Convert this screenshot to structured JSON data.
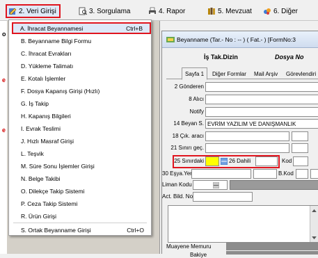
{
  "menubar": {
    "items": [
      {
        "label": "2. Veri Girişi",
        "icon": "data-entry-icon"
      },
      {
        "label": "3. Sorgulama",
        "icon": "query-icon"
      },
      {
        "label": "4. Rapor",
        "icon": "report-icon"
      },
      {
        "label": "5. Mevzuat",
        "icon": "legislation-icon"
      },
      {
        "label": "6. Diğer",
        "icon": "other-icon"
      }
    ]
  },
  "left_strip": {
    "letters": [
      "o",
      "e",
      "e"
    ]
  },
  "dropdown": {
    "items": [
      {
        "label": "A. İhracat Beyannamesi",
        "shortcut": "Ctrl+B"
      },
      {
        "label": "B. Beyanname Bilgi Formu",
        "shortcut": ""
      },
      {
        "label": "C. İhracat Evrakları",
        "shortcut": ""
      },
      {
        "label": "D. Yükleme Talimatı",
        "shortcut": ""
      },
      {
        "label": "E. Kotalı İşlemler",
        "shortcut": ""
      },
      {
        "label": "F. Dosya Kapanış Girişi (Hızlı)",
        "shortcut": ""
      },
      {
        "label": "G. İş Takip",
        "shortcut": ""
      },
      {
        "label": "H. Kapanış Bilgileri",
        "shortcut": ""
      },
      {
        "label": "I. Evrak Teslimi",
        "shortcut": ""
      },
      {
        "label": "J. Hızlı Masraf Girişi",
        "shortcut": ""
      },
      {
        "label": "L. Teşvik",
        "shortcut": ""
      },
      {
        "label": "M. Süre Sonu İşlemler Girişi",
        "shortcut": ""
      },
      {
        "label": "N. Belge Takibi",
        "shortcut": ""
      },
      {
        "label": "O. Dilekçe Takip Sistemi",
        "shortcut": ""
      },
      {
        "label": "P. Ceza Takip Sistemi",
        "shortcut": ""
      },
      {
        "label": "R. Ürün Girişi",
        "shortcut": ""
      },
      {
        "label": "S. Ortak Beyanname Girişi",
        "shortcut": "Ctrl+O"
      }
    ]
  },
  "form": {
    "title": "Beyanname (Tar.- No : -- ) ( Fat.- ) [FormNo:3",
    "header_left": "İş Tak.Dizin",
    "header_right": "Dosya No",
    "tabs": [
      "Sayfa 1",
      "Diğer Formlar",
      "Mail Arşiv",
      "Görevlendiri"
    ],
    "fields": {
      "gonderen": "2 Gönderen",
      "alici": "8 Alıcı",
      "notify": "Notify",
      "beyan_label": "14 Beyan S.",
      "beyan_value": "EVRİM YAZILIM VE DANIŞMANLIK",
      "cik_arac": "18 Çık. aracı",
      "sinir_gec": "21 Sınırı geç.",
      "sinirdaki": "25 Sınırdaki",
      "dahili": "26 Dahili",
      "kod": "Kod",
      "esya_yeri": "30 Eşya.Yeri",
      "bkod": "B.Kod",
      "liman_kodu": "Liman Kodu",
      "act_bild": "Act. Bild. No",
      "muayene": "Muayene Memuru",
      "bakiye": "Bakiye"
    }
  },
  "colors": {
    "highlight": "#e0141e",
    "yellow": "#ffff00"
  }
}
